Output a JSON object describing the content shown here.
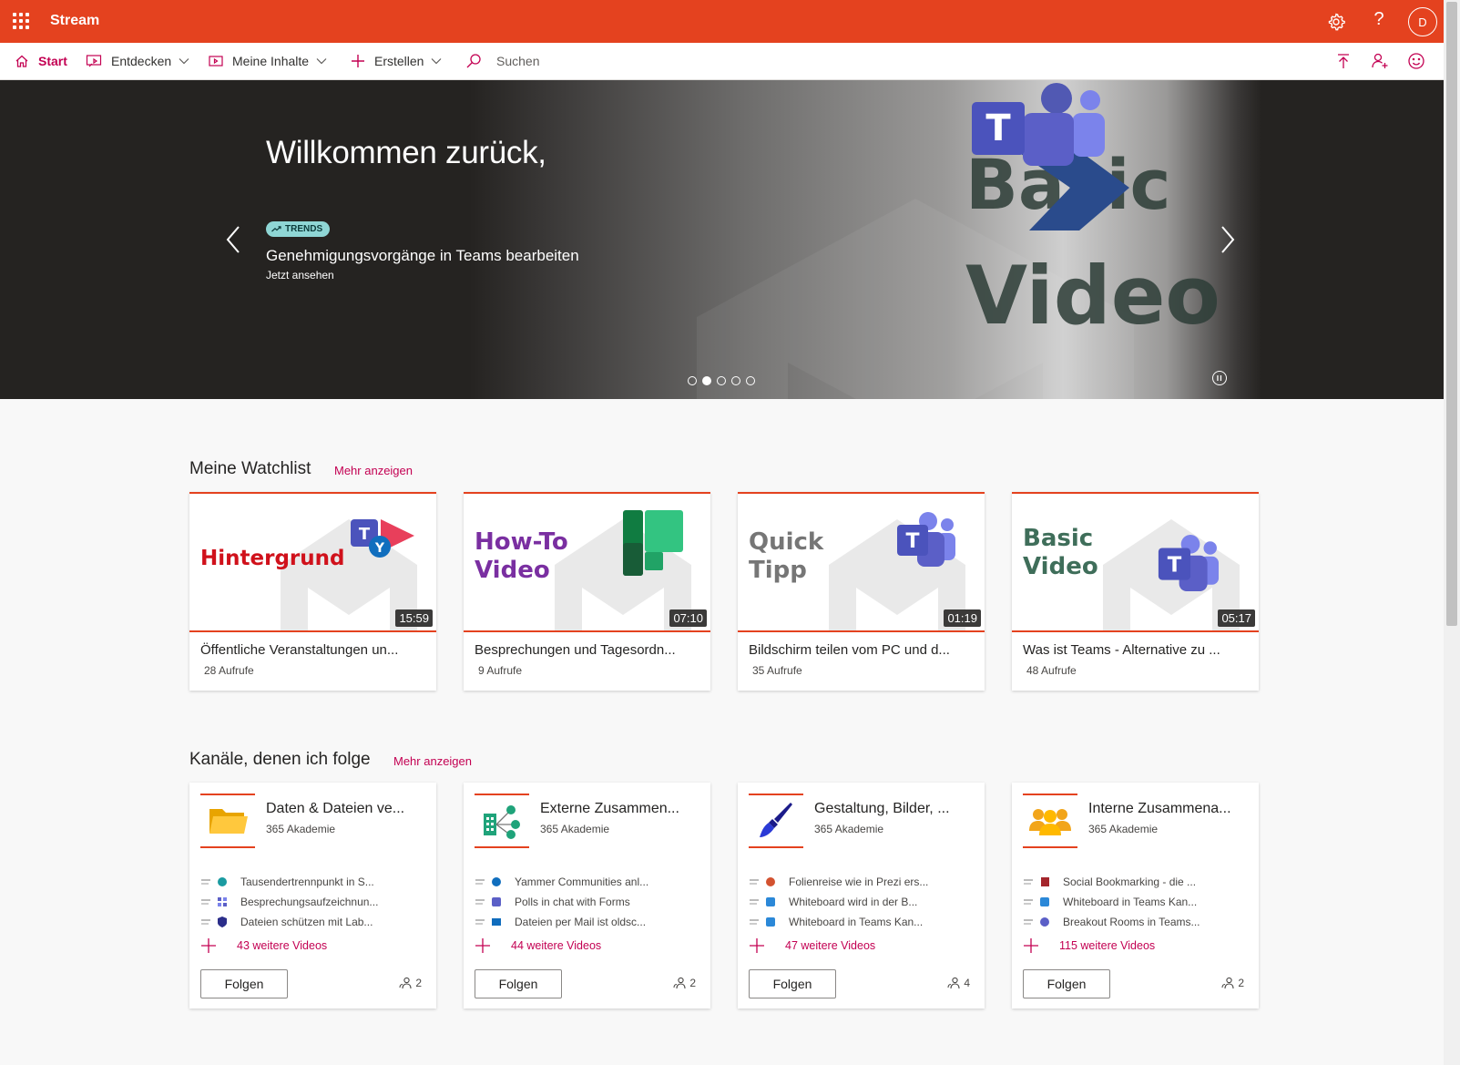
{
  "topbar": {
    "app_title": "Stream",
    "avatar_initial": "D",
    "help_glyph": "?"
  },
  "nav": {
    "start": "Start",
    "entdecken": "Entdecken",
    "meine_inhalte": "Meine Inhalte",
    "erstellen": "Erstellen",
    "search_placeholder": "Suchen"
  },
  "hero": {
    "welcome": "Willkommen zurück,",
    "badge": "TRENDS",
    "video_title": "Genehmigungsvorgänge in Teams bearbeiten",
    "cta": "Jetzt ansehen",
    "bg_text_1": "Basic",
    "bg_text_2": "Video",
    "slide_count": 5,
    "active_slide": 2
  },
  "watchlist": {
    "title": "Meine Watchlist",
    "more": "Mehr anzeigen",
    "videos": [
      {
        "thumb_text": "Hintergrund",
        "duration": "15:59",
        "title": "Öffentliche Veranstaltungen un...",
        "views": "28 Aufrufe",
        "thumb_color": "#d0111b",
        "icon": "teams-yammer-stream-icon"
      },
      {
        "thumb_text": "How-To Video",
        "duration": "07:10",
        "title": "Besprechungen und Tagesordn...",
        "views": "9 Aufrufe",
        "thumb_color": "#7a2fa1",
        "icon": "planner-icon"
      },
      {
        "thumb_text": "Quick Tipp",
        "duration": "01:19",
        "title": "Bildschirm teilen vom PC und d...",
        "views": "35 Aufrufe",
        "thumb_color": "#767676",
        "icon": "teams-icon"
      },
      {
        "thumb_text": "Basic Video",
        "duration": "05:17",
        "title": "Was ist Teams - Alternative zu ...",
        "views": "48 Aufrufe",
        "thumb_color": "#3f6e5a",
        "icon": "teams-icon"
      }
    ]
  },
  "channels": {
    "title": "Kanäle, denen ich folge",
    "more": "Mehr anzeigen",
    "follow_label": "Folgen",
    "items": [
      {
        "name": "Daten & Dateien ve...",
        "org": "365 Akademie",
        "icon": "folder-icon",
        "videos": [
          "Tausendertrennpunkt in S...",
          "Besprechungsaufzeichnun...",
          "Dateien schützen mit Lab..."
        ],
        "more": "43 weitere Videos",
        "followers": "2"
      },
      {
        "name": "Externe Zusammen...",
        "org": "365 Akademie",
        "icon": "external-share-icon",
        "videos": [
          "Yammer Communities anl...",
          "Polls in chat with Forms",
          "Dateien per Mail ist oldsc..."
        ],
        "more": "44 weitere Videos",
        "followers": "2"
      },
      {
        "name": "Gestaltung, Bilder, ...",
        "org": "365 Akademie",
        "icon": "paintbrush-icon",
        "videos": [
          "Folienreise wie in Prezi ers...",
          "Whiteboard wird in der B...",
          "Whiteboard in Teams Kan..."
        ],
        "more": "47 weitere Videos",
        "followers": "4"
      },
      {
        "name": "Interne Zusammena...",
        "org": "365 Akademie",
        "icon": "people-group-icon",
        "videos": [
          "Social Bookmarking - die ...",
          "Whiteboard in Teams Kan...",
          "Breakout Rooms in Teams..."
        ],
        "more": "115 weitere Videos",
        "followers": "2"
      }
    ]
  },
  "colors": {
    "brand": "#e4421f",
    "accent": "#c30052"
  }
}
